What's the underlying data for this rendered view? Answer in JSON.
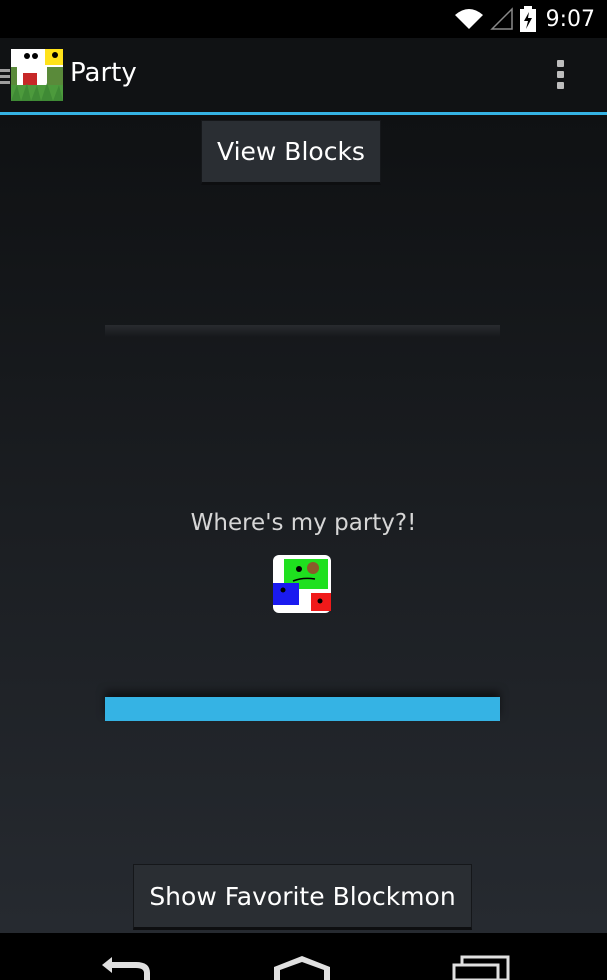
{
  "status_bar": {
    "time": "9:07",
    "icons": [
      "wifi-icon",
      "signal-icon",
      "battery-charging-icon"
    ]
  },
  "action_bar": {
    "title": "Party",
    "app_icon": "app-logo-icon",
    "overflow_icon": "overflow-menu-icon"
  },
  "main": {
    "view_blocks_label": "View Blocks",
    "empty_message": "Where's my party?!",
    "blockmon_icon": "blockmon-icon",
    "progress": 1.0,
    "show_favorite_label": "Show Favorite Blockmon"
  },
  "nav_bar": {
    "buttons": [
      "back-icon",
      "home-icon",
      "recent-apps-icon"
    ]
  },
  "colors": {
    "accent": "#35b3e4",
    "action_bar_bg": "#101214",
    "button_bg": "#2a2e33"
  }
}
